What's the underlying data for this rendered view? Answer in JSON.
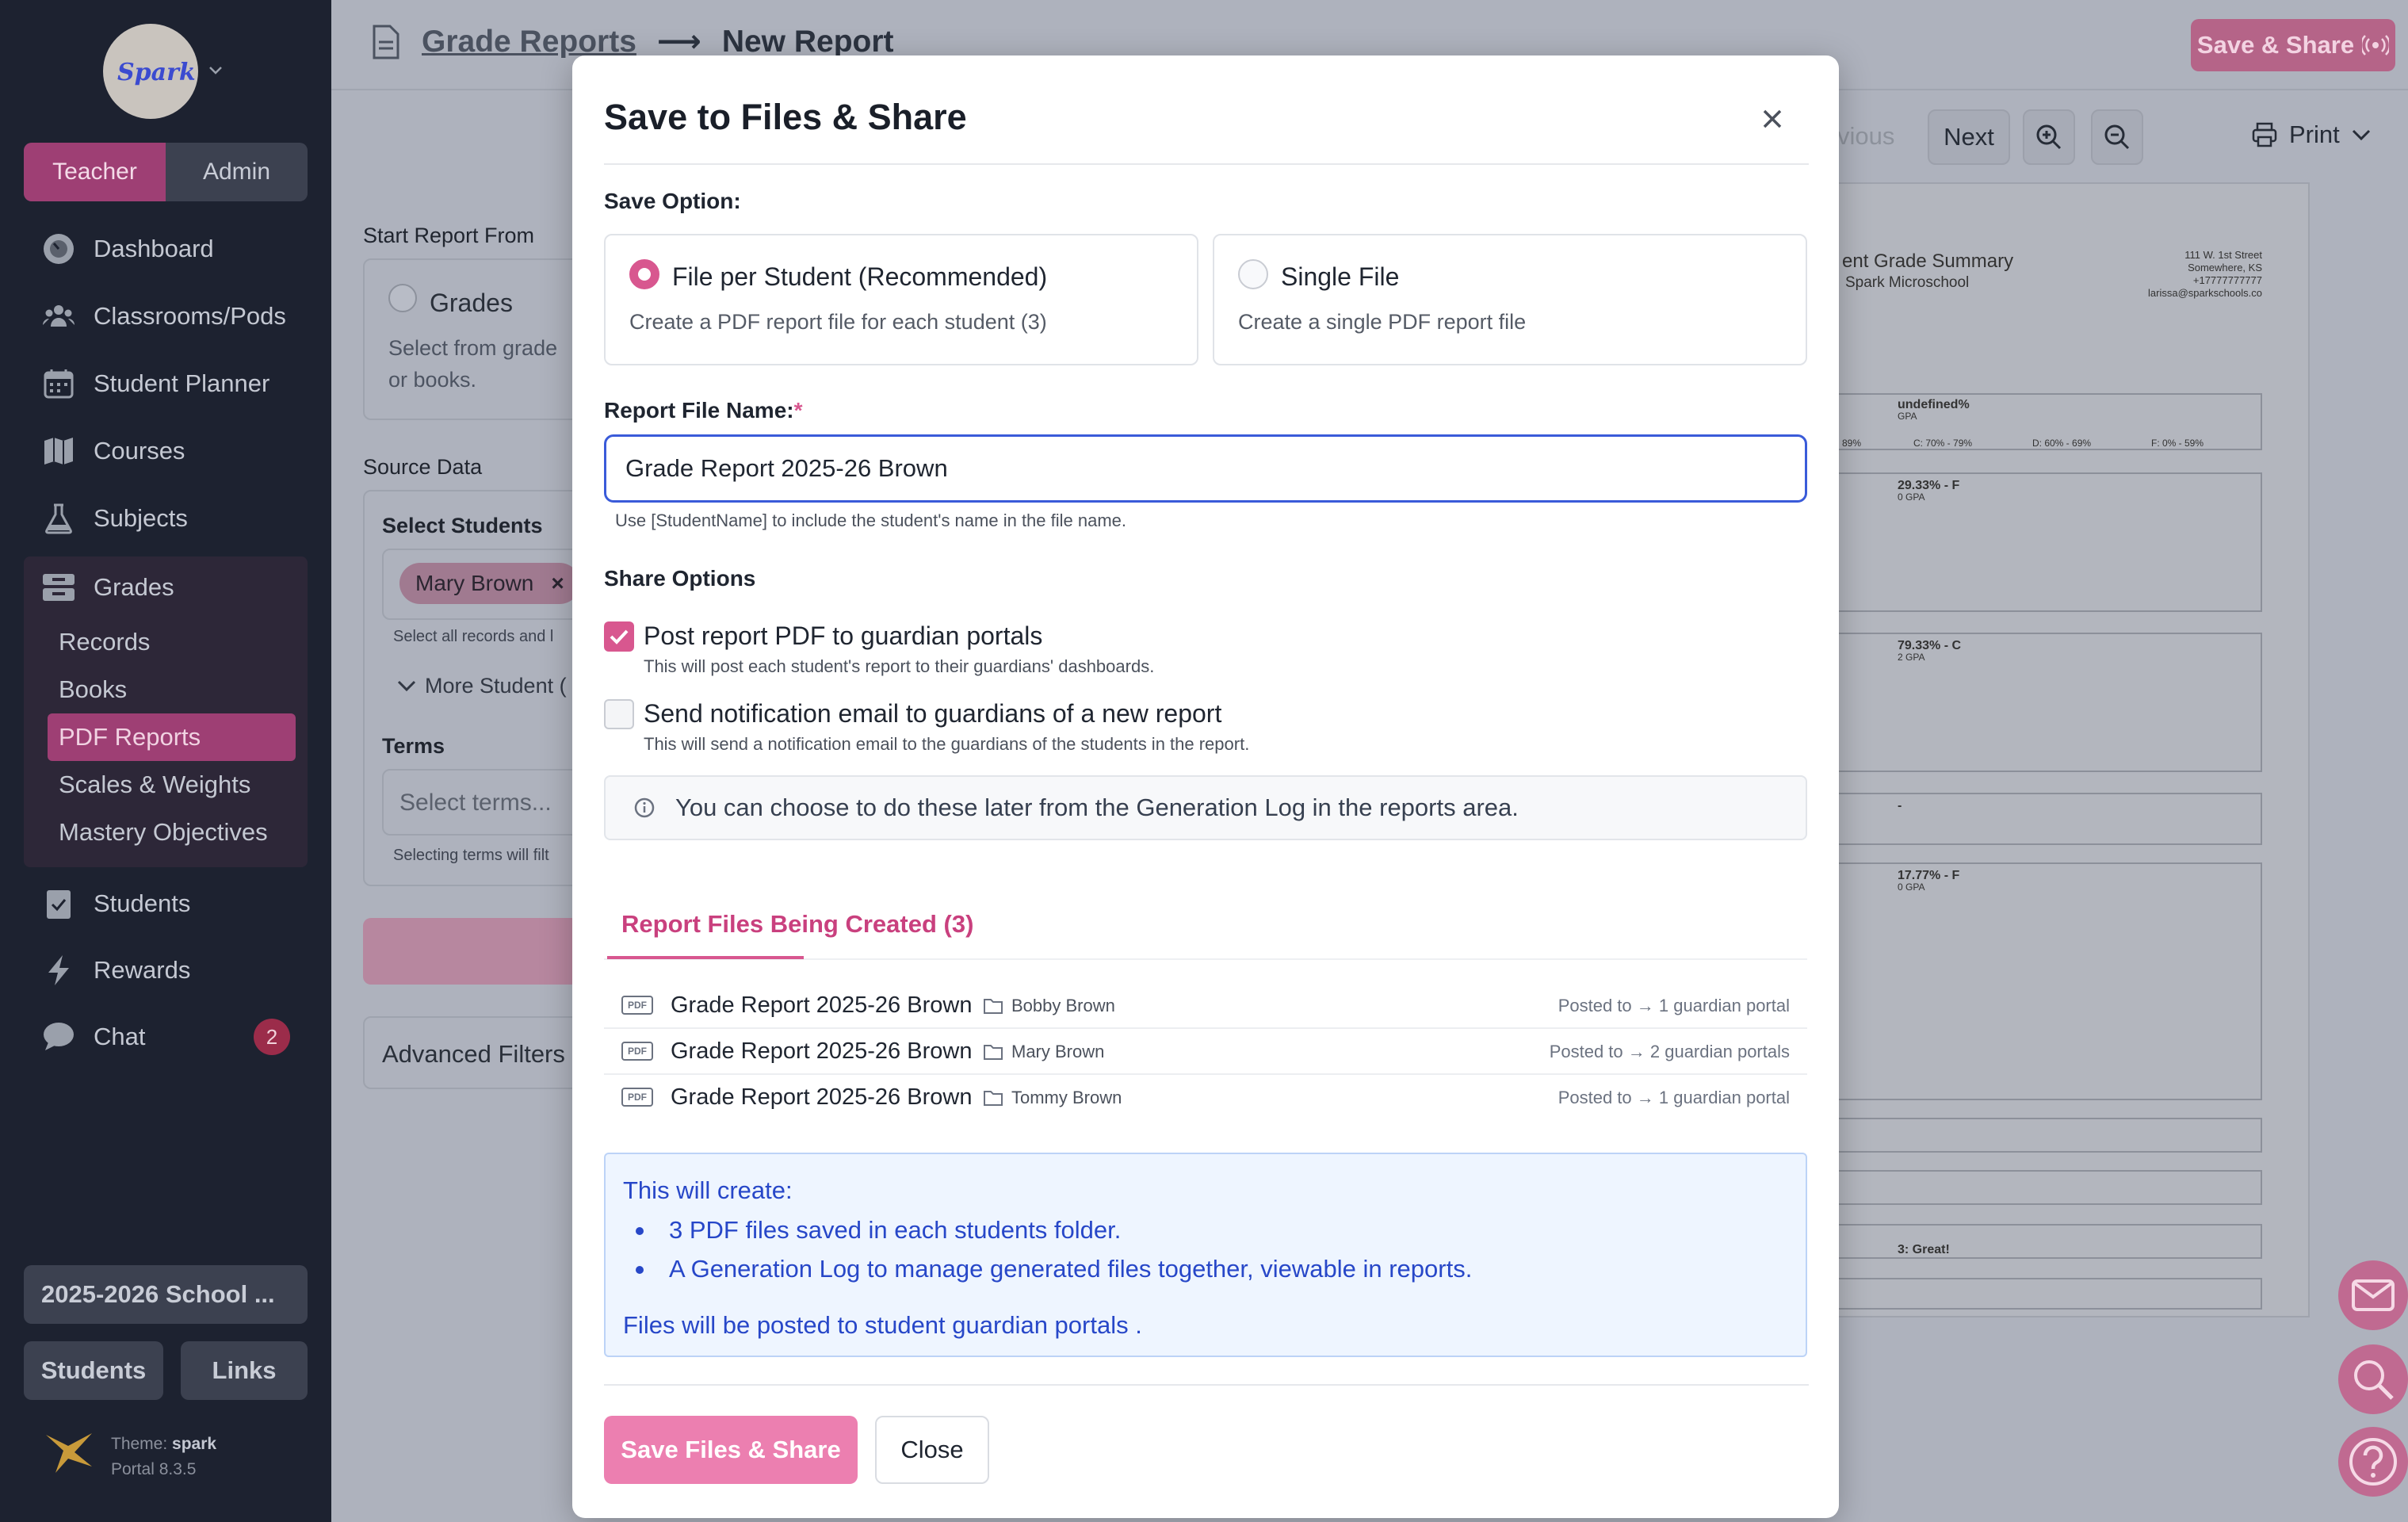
{
  "sidebar": {
    "logo_text": "Spark",
    "roles": [
      "Teacher",
      "Admin"
    ],
    "nav": [
      {
        "label": "Dashboard",
        "icon": "gauge-icon"
      },
      {
        "label": "Classrooms/Pods",
        "icon": "users-icon"
      },
      {
        "label": "Student Planner",
        "icon": "calendar-icon"
      },
      {
        "label": "Courses",
        "icon": "map-icon"
      },
      {
        "label": "Subjects",
        "icon": "flask-icon"
      },
      {
        "label": "Grades",
        "icon": "inbox-icon"
      },
      {
        "label": "Students",
        "icon": "clipboard-check-icon"
      },
      {
        "label": "Rewards",
        "icon": "bolt-icon"
      },
      {
        "label": "Chat",
        "icon": "chat-icon",
        "badge": "2"
      }
    ],
    "grades_sub": [
      "Records",
      "Books",
      "PDF Reports",
      "Scales & Weights",
      "Mastery Objectives"
    ],
    "school_year": "2025-2026 School ...",
    "students_btn": "Students",
    "links_btn": "Links",
    "theme_label": "Theme:",
    "theme_name": "spark",
    "portal_version": "Portal 8.3.5"
  },
  "header": {
    "breadcrumb_link": "Grade Reports",
    "breadcrumb_arrow": "⟶",
    "breadcrumb_current": "New Report",
    "save_share": "Save & Share"
  },
  "background": {
    "start_report_from": "Start Report From",
    "grades_option": "Grades",
    "grades_desc_1": "Select from grade",
    "grades_desc_2": "or books.",
    "source_data": "Source Data",
    "select_students": "Select Students",
    "chip_student": "Mary Brown",
    "chip_remove": "×",
    "select_all_hint": "Select all records and l",
    "more_student": "More Student (",
    "terms": "Terms",
    "terms_placeholder": "Select terms...",
    "terms_hint": "Selecting terms will filt",
    "advanced_filters": "Advanced Filters",
    "previous": "vious",
    "next": "Next",
    "print": "Print",
    "preview": {
      "title": "ent Grade Summary",
      "school": "Spark Microschool",
      "address": [
        "111 W. 1st Street",
        "Somewhere, KS",
        "+17777777777",
        "larissa@sparkschools.co"
      ],
      "rows": [
        {
          "pct": "undefined%",
          "gpa": "GPA"
        },
        {
          "pct": "29.33% - F",
          "gpa": "0 GPA"
        },
        {
          "pct": "79.33% - C",
          "gpa": "2 GPA"
        },
        {
          "pct": "-",
          "gpa": ""
        },
        {
          "pct": "17.77% - F",
          "gpa": "0 GPA"
        },
        {
          "pct": "3: Great!",
          "gpa": ""
        }
      ],
      "scale": [
        "89%",
        "C: 70% - 79%",
        "D: 60% - 69%",
        "F: 0% - 59%"
      ]
    }
  },
  "modal": {
    "title": "Save to Files & Share",
    "save_option_label": "Save Option:",
    "option_per_student_title": "File per Student (Recommended)",
    "option_per_student_desc": "Create a PDF report file for each student (3)",
    "option_single_title": "Single File",
    "option_single_desc": "Create a single PDF report file",
    "file_name_label": "Report File Name:",
    "required_mark": "*",
    "file_name_value": "Grade Report 2025-26 Brown",
    "file_name_hint": "Use [StudentName] to include the student's name in the file name.",
    "share_options_label": "Share Options",
    "post_portal_label": "Post report PDF to guardian portals",
    "post_portal_checked": true,
    "post_portal_desc": "This will post each student's report to their guardians' dashboards.",
    "notify_label": "Send notification email to guardians of a new report",
    "notify_checked": false,
    "notify_desc": "This will send a notification email to the guardians of the students in the report.",
    "info_text": "You can choose to do these later from the Generation Log in the reports area.",
    "tab_label": "Report Files Being Created (3)",
    "files": [
      {
        "name": "Grade Report 2025-26 Brown",
        "student": "Bobby Brown",
        "posted": "Posted to → 1 guardian portal"
      },
      {
        "name": "Grade Report 2025-26 Brown",
        "student": "Mary Brown",
        "posted": "Posted to → 2 guardian portals"
      },
      {
        "name": "Grade Report 2025-26 Brown",
        "student": "Tommy Brown",
        "posted": "Posted to → 1 guardian portal"
      }
    ],
    "pdf_badge": "PDF",
    "create_heading": "This will create:",
    "create_items": [
      "3 PDF files saved in each students folder.",
      "A Generation Log to manage generated files together, viewable in reports."
    ],
    "create_footer": "Files will be posted to student guardian portals .",
    "save_button": "Save Files & Share",
    "close_button": "Close"
  },
  "colors": {
    "accent": "#d8578f",
    "sidebar_bg": "#1d2230",
    "info_blue": "#2747c8"
  }
}
